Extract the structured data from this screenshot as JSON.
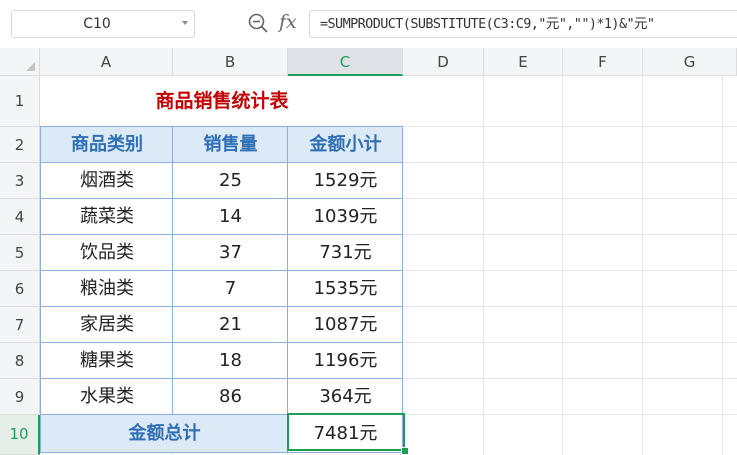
{
  "formula_bar": {
    "name_box": "C10",
    "fx_label": "fx",
    "formula": "=SUMPRODUCT(SUBSTITUTE(C3:C9,\"元\",\"\")*1)&\"元\""
  },
  "icons": {
    "zoom": "zoom-formula-icon",
    "fx": "function-icon",
    "dropdown": "chevron-down-icon"
  },
  "columns": [
    "A",
    "B",
    "C",
    "D",
    "E",
    "F",
    "G"
  ],
  "rows": [
    "1",
    "2",
    "3",
    "4",
    "5",
    "6",
    "7",
    "8",
    "9",
    "10"
  ],
  "active_column": "C",
  "active_row": "10",
  "sheet": {
    "title": "商品销售统计表",
    "headers": [
      "商品类别",
      "销售量",
      "金额小计"
    ],
    "data": [
      {
        "category": "烟酒类",
        "qty": "25",
        "amount": "1529元"
      },
      {
        "category": "蔬菜类",
        "qty": "14",
        "amount": "1039元"
      },
      {
        "category": "饮品类",
        "qty": "37",
        "amount": "731元"
      },
      {
        "category": "粮油类",
        "qty": "7",
        "amount": "1535元"
      },
      {
        "category": "家居类",
        "qty": "21",
        "amount": "1087元"
      },
      {
        "category": "糖果类",
        "qty": "18",
        "amount": "1196元"
      },
      {
        "category": "水果类",
        "qty": "86",
        "amount": "364元"
      }
    ],
    "total_label": "金额总计",
    "total_value": "7481元"
  },
  "colors": {
    "accent_green": "#1e9d58",
    "title_red": "#c00000",
    "header_blue_bg": "#dce9f6",
    "header_blue_text": "#2e6fb5"
  }
}
